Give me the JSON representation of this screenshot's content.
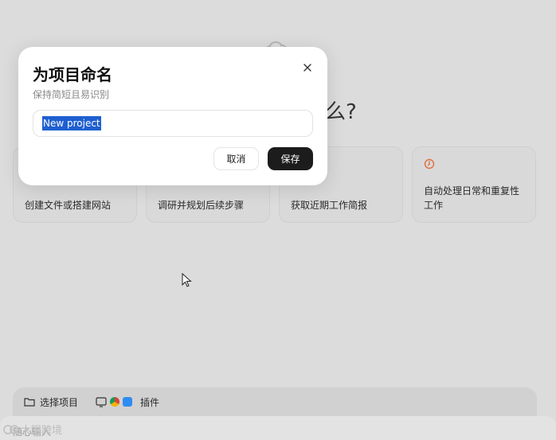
{
  "dialog": {
    "title": "为项目命名",
    "subtitle": "保持简短且易识别",
    "input_value": "New project",
    "cancel_label": "取消",
    "save_label": "保存",
    "close_icon": "close-icon"
  },
  "background": {
    "headline_tail": "么?",
    "cards": [
      {
        "label": "创建文件或搭建网站"
      },
      {
        "label": "调研并规划后续步骤"
      },
      {
        "label": "获取近期工作简报"
      },
      {
        "label": "自动处理日常和重复性工作",
        "icon": "clock-icon"
      }
    ],
    "composer": {
      "select_project_label": "选择项目",
      "plugins_label": "插件",
      "input_placeholder": "随心输入"
    }
  },
  "watermark": {
    "text": "大眼跨境"
  },
  "colors": {
    "background": "#dcdcdc",
    "dialog": "#ffffff",
    "save_button": "#1c1c1c",
    "selection": "#1f5fd1",
    "clock_icon": "#e07040"
  }
}
